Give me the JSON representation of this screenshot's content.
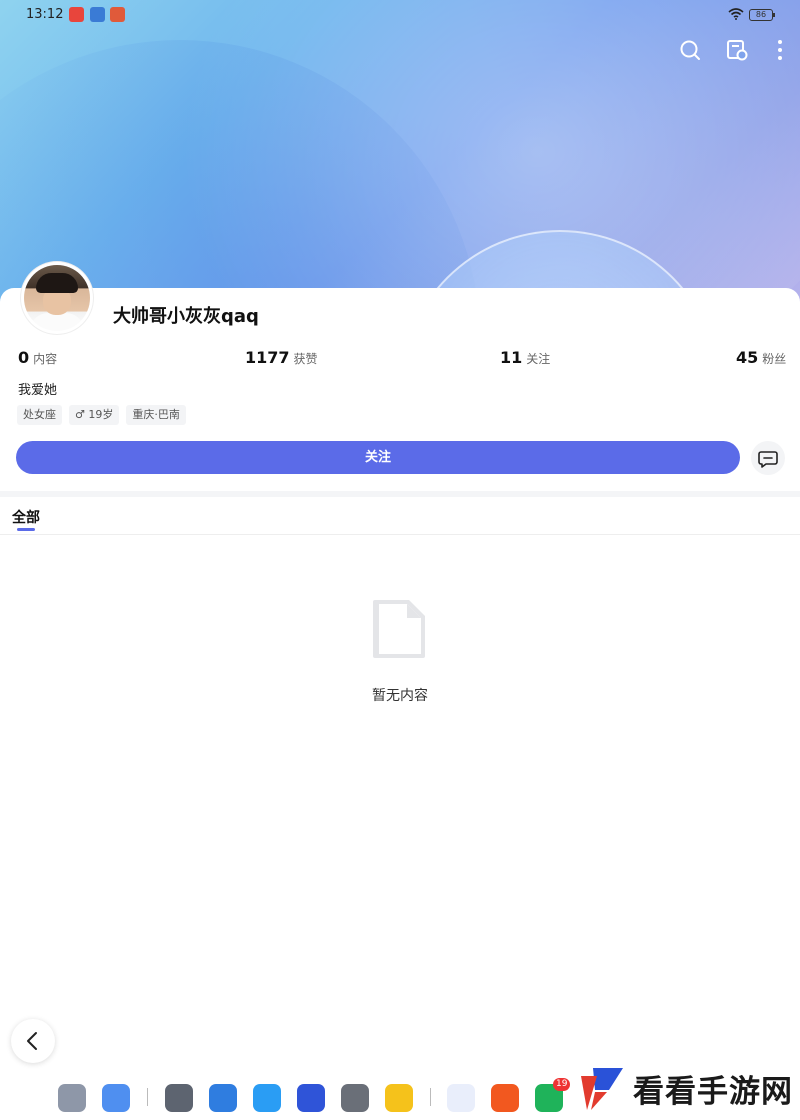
{
  "status_bar": {
    "time": "13:12",
    "battery": "86"
  },
  "profile": {
    "username": "大帅哥小灰灰qaq",
    "bio": "我爱她",
    "stats": [
      {
        "value": "0",
        "label": "内容"
      },
      {
        "value": "1177",
        "label": "获赞"
      },
      {
        "value": "11",
        "label": "关注"
      },
      {
        "value": "45",
        "label": "粉丝"
      }
    ],
    "tags": [
      "处女座",
      "♂ 19岁",
      "重庆·巴南"
    ]
  },
  "actions": {
    "follow_label": "关注"
  },
  "tabs": [
    {
      "label": "全部",
      "active": true
    }
  ],
  "empty_state": {
    "message": "暂无内容"
  },
  "dock": {
    "badge_count": "19"
  },
  "watermark": {
    "text": "看看手游网"
  },
  "colors": {
    "accent": "#5b6be8",
    "banner_start": "#8fd3ef",
    "banner_end": "#b7b3ec"
  },
  "icons": [
    "search-icon",
    "share-card-icon",
    "more-icon",
    "message-icon",
    "back-icon",
    "empty-document-icon"
  ]
}
